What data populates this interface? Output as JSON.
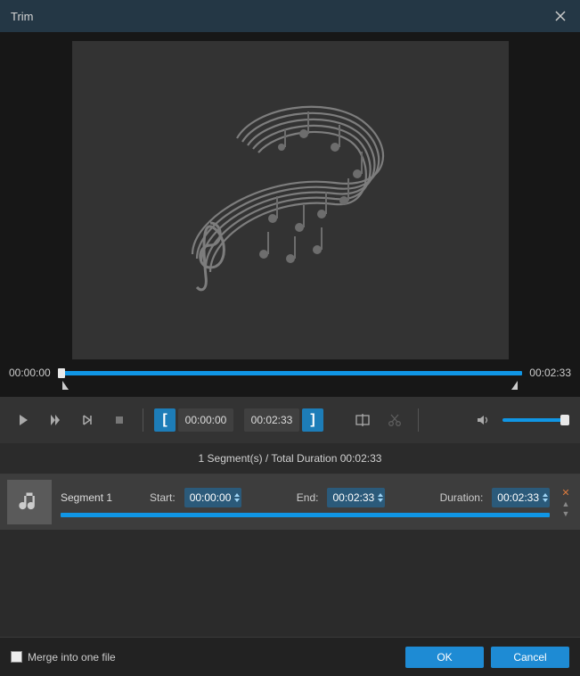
{
  "titlebar": {
    "title": "Trim"
  },
  "preview": {
    "start_time": "00:00:00",
    "end_time": "00:02:33"
  },
  "controls": {
    "trim_start": "00:00:00",
    "trim_end": "00:02:33"
  },
  "summary": {
    "text": "1 Segment(s) / Total Duration 00:02:33"
  },
  "segment": {
    "name": "Segment 1",
    "start_label": "Start:",
    "start_value": "00:00:00",
    "end_label": "End:",
    "end_value": "00:02:33",
    "duration_label": "Duration:",
    "duration_value": "00:02:33"
  },
  "footer": {
    "merge_label": "Merge into one file",
    "ok": "OK",
    "cancel": "Cancel"
  }
}
